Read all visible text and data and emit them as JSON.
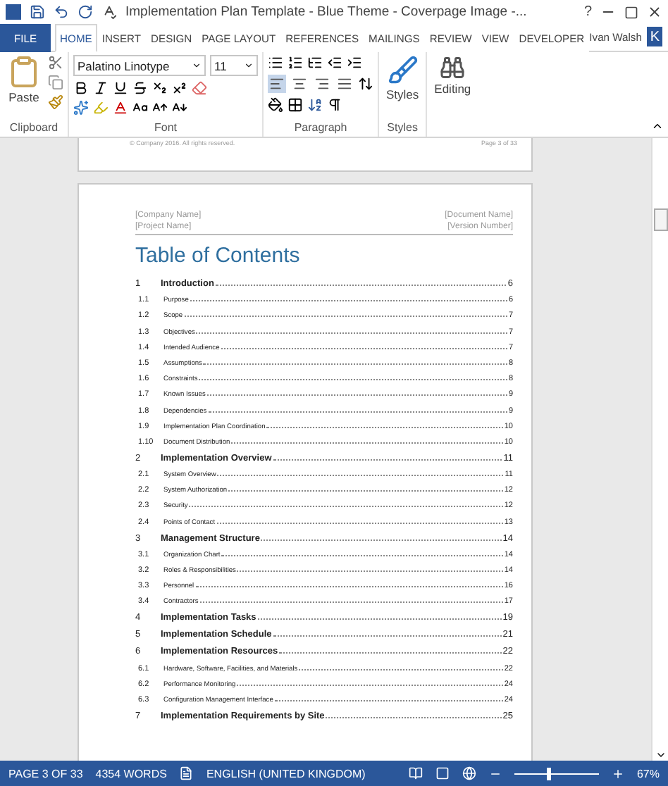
{
  "title_bar": {
    "title": "Implementation Plan Template - Blue Theme - Coverpage Image -...",
    "help": "?"
  },
  "tabs": [
    {
      "label": "FILE",
      "kind": "file",
      "selected": false
    },
    {
      "label": "HOME",
      "kind": "tab",
      "selected": true
    },
    {
      "label": "INSERT",
      "kind": "tab",
      "selected": false
    },
    {
      "label": "DESIGN",
      "kind": "tab",
      "selected": false
    },
    {
      "label": "PAGE LAYOUT",
      "kind": "tab",
      "selected": false
    },
    {
      "label": "REFERENCES",
      "kind": "tab",
      "selected": false
    },
    {
      "label": "MAILINGS",
      "kind": "tab",
      "selected": false
    },
    {
      "label": "REVIEW",
      "kind": "tab",
      "selected": false
    },
    {
      "label": "VIEW",
      "kind": "tab",
      "selected": false
    },
    {
      "label": "DEVELOPER",
      "kind": "tab",
      "selected": false
    }
  ],
  "account": {
    "name": "Ivan Walsh",
    "avatar": "K"
  },
  "ribbon": {
    "clipboard": {
      "label": "Clipboard",
      "paste": "Paste"
    },
    "font": {
      "label": "Font",
      "font_name": "Palatino Linotype",
      "font_size": "11"
    },
    "paragraph": {
      "label": "Paragraph",
      "alignments": [
        {
          "kind": "left",
          "selected": true
        },
        {
          "kind": "center",
          "selected": false
        },
        {
          "kind": "right",
          "selected": false
        },
        {
          "kind": "justify",
          "selected": false
        }
      ]
    },
    "styles": {
      "label": "Styles",
      "button": "Styles"
    },
    "editing": {
      "button": "Editing"
    }
  },
  "document": {
    "previous_footer": {
      "left": "© Company 2016. All rights reserved.",
      "right": "Page 3 of 33"
    },
    "header": {
      "company": "[Company Name]",
      "project": "[Project Name]",
      "document": "[Document Name]",
      "version": "[Version Number]"
    },
    "heading": "Table of Contents",
    "toc": [
      {
        "kind": "main",
        "number": "1",
        "title": "Introduction",
        "page": "6"
      },
      {
        "kind": "sub",
        "number": "1.1",
        "title": "Purpose",
        "page": "6"
      },
      {
        "kind": "sub",
        "number": "1.2",
        "title": "Scope",
        "page": "7"
      },
      {
        "kind": "sub",
        "number": "1.3",
        "title": "Objectives",
        "page": "7"
      },
      {
        "kind": "sub",
        "number": "1.4",
        "title": "Intended Audience",
        "page": "7"
      },
      {
        "kind": "sub",
        "number": "1.5",
        "title": "Assumptions",
        "page": "8"
      },
      {
        "kind": "sub",
        "number": "1.6",
        "title": "Constraints",
        "page": "8"
      },
      {
        "kind": "sub",
        "number": "1.7",
        "title": "Known Issues",
        "page": "9"
      },
      {
        "kind": "sub",
        "number": "1.8",
        "title": "Dependencies",
        "page": "9"
      },
      {
        "kind": "sub",
        "number": "1.9",
        "title": "Implementation Plan Coordination",
        "page": "10"
      },
      {
        "kind": "sub",
        "number": "1.10",
        "title": "Document Distribution",
        "page": "10"
      },
      {
        "kind": "main",
        "number": "2",
        "title": "Implementation Overview",
        "page": "11"
      },
      {
        "kind": "sub",
        "number": "2.1",
        "title": "System Overview",
        "page": "11"
      },
      {
        "kind": "sub",
        "number": "2.2",
        "title": "System Authorization",
        "page": "12"
      },
      {
        "kind": "sub",
        "number": "2.3",
        "title": "Security",
        "page": "12"
      },
      {
        "kind": "sub",
        "number": "2.4",
        "title": "Points of Contact",
        "page": "13"
      },
      {
        "kind": "main",
        "number": "3",
        "title": "Management Structure",
        "page": "14"
      },
      {
        "kind": "sub",
        "number": "3.1",
        "title": "Organization Chart",
        "page": "14"
      },
      {
        "kind": "sub",
        "number": "3.2",
        "title": "Roles & Responsibilities",
        "page": "14"
      },
      {
        "kind": "sub",
        "number": "3.3",
        "title": "Personnel",
        "page": "16"
      },
      {
        "kind": "sub",
        "number": "3.4",
        "title": "Contractors",
        "page": "17"
      },
      {
        "kind": "main",
        "number": "4",
        "title": "Implementation Tasks",
        "page": "19"
      },
      {
        "kind": "main",
        "number": "5",
        "title": "Implementation Schedule",
        "page": "21"
      },
      {
        "kind": "main",
        "number": "6",
        "title": "Implementation Resources",
        "page": "22"
      },
      {
        "kind": "sub",
        "number": "6.1",
        "title": "Hardware, Software, Facilities, and Materials",
        "page": "22"
      },
      {
        "kind": "sub",
        "number": "6.2",
        "title": "Performance Monitoring",
        "page": "24"
      },
      {
        "kind": "sub",
        "number": "6.3",
        "title": "Configuration Management Interface",
        "page": "24"
      },
      {
        "kind": "main",
        "number": "7",
        "title": "Implementation Requirements by Site",
        "page": "25"
      }
    ]
  },
  "status_bar": {
    "page": "PAGE 3 OF 33",
    "words": "4354 WORDS",
    "language": "ENGLISH (UNITED KINGDOM)",
    "zoom": {
      "level": 0.4,
      "reading": "67%"
    }
  }
}
